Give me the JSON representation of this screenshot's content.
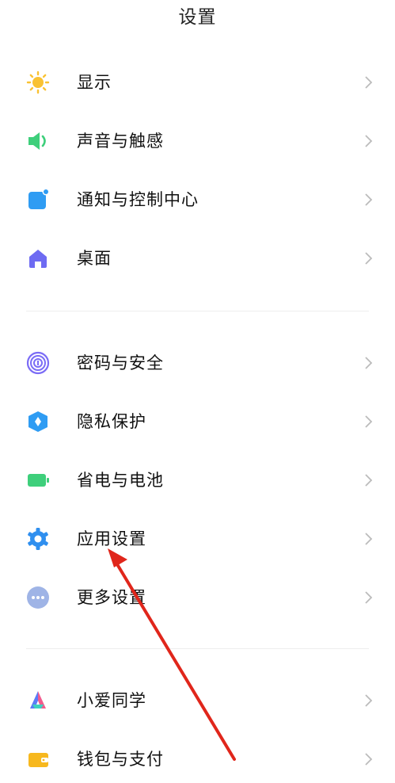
{
  "header": {
    "title": "设置"
  },
  "groups": [
    {
      "items": [
        {
          "label": "显示",
          "icon": "sun-icon",
          "color": "#F9C232"
        },
        {
          "label": "声音与触感",
          "icon": "speaker-icon",
          "color": "#3ECF7B"
        },
        {
          "label": "通知与控制中心",
          "icon": "notification-icon",
          "color": "#2F9CF3"
        },
        {
          "label": "桌面",
          "icon": "home-icon",
          "color": "#6E6BF2"
        }
      ]
    },
    {
      "items": [
        {
          "label": "密码与安全",
          "icon": "fingerprint-icon",
          "color": "#7B6CF6"
        },
        {
          "label": "隐私保护",
          "icon": "shield-icon",
          "color": "#2F9CF3"
        },
        {
          "label": "省电与电池",
          "icon": "battery-icon",
          "color": "#3ECF7B"
        },
        {
          "label": "应用设置",
          "icon": "gear-icon",
          "color": "#2F8FEF"
        },
        {
          "label": "更多设置",
          "icon": "more-icon",
          "color": "#9FB4E6"
        }
      ]
    },
    {
      "items": [
        {
          "label": "小爱同学",
          "icon": "xiaoai-icon",
          "color": "#5B7CF6"
        },
        {
          "label": "钱包与支付",
          "icon": "wallet-icon",
          "color": "#F7B81E"
        }
      ]
    }
  ],
  "annotation": {
    "type": "arrow",
    "color": "#E0261B",
    "points_to": "应用设置"
  }
}
